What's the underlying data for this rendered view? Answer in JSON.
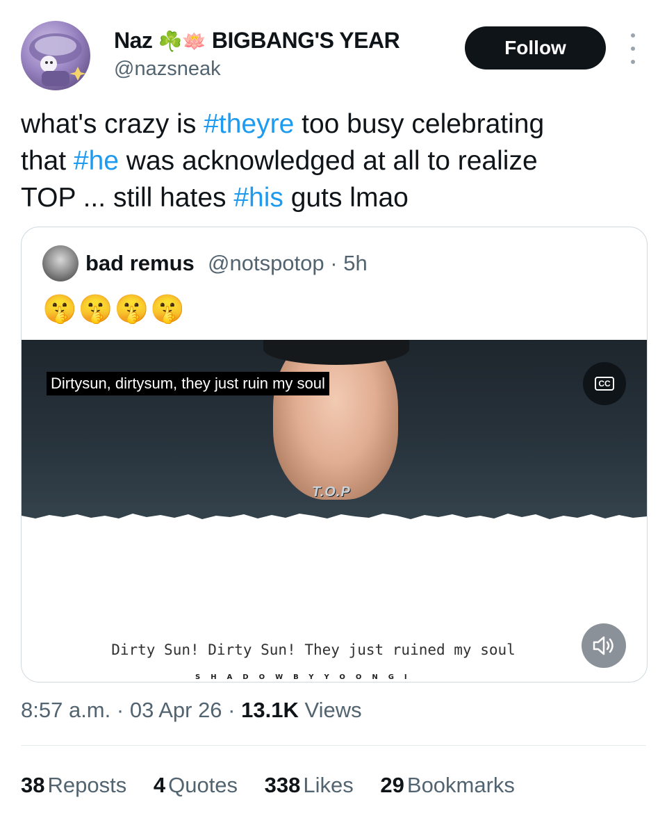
{
  "author": {
    "display_name": "Naz",
    "name_emojis": "☘️🪷",
    "name_suffix": "BIGBANG'S YEAR",
    "handle": "@nazsneak"
  },
  "follow_label": "Follow",
  "tweet": {
    "line1_pre": "what's crazy is ",
    "tag1": "#theyre",
    "line1_post": " too busy celebrating",
    "line2_pre": "that ",
    "tag2": "#he",
    "line2_post": " was acknowledged at all to realize",
    "line3_pre": "TOP ... still hates ",
    "tag3": "#his",
    "line3_post": " guts lmao"
  },
  "quote": {
    "name": "bad remus",
    "handle": "@notspotop",
    "time": "5h",
    "separator": "·",
    "emojis": "🤫🤫🤫🤫",
    "video": {
      "caption": "Dirtysun, dirtysum, they just ruin my soul",
      "cc_label": "CC",
      "overlay_label": "T.O.P",
      "lyrics": "Dirty Sun! Dirty Sun! They just ruined my soul",
      "watermark": "SHADOWBYYOONGI"
    }
  },
  "meta": {
    "time": "8:57 a.m.",
    "date": "03 Apr 26",
    "separator": "·",
    "views_count": "13.1K",
    "views_label": "Views"
  },
  "stats": {
    "reposts_count": "38",
    "reposts_label": "Reposts",
    "quotes_count": "4",
    "quotes_label": "Quotes",
    "likes_count": "338",
    "likes_label": "Likes",
    "bookmarks_count": "29",
    "bookmarks_label": "Bookmarks"
  },
  "colors": {
    "link": "#1d9bf0",
    "muted": "#536471",
    "text": "#0f1419"
  },
  "icons": [
    "more-icon",
    "cc-icon",
    "volume-icon"
  ]
}
